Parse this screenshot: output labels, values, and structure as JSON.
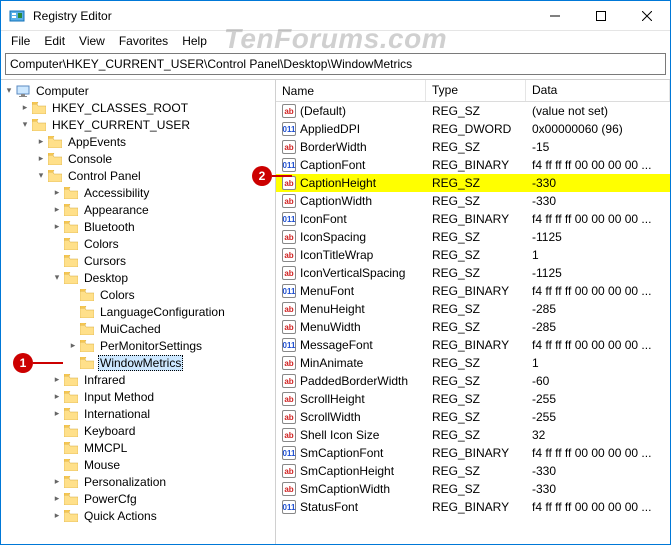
{
  "window": {
    "title": "Registry Editor"
  },
  "watermark": "TenForums.com",
  "menubar": [
    "File",
    "Edit",
    "View",
    "Favorites",
    "Help"
  ],
  "pathbar": "Computer\\HKEY_CURRENT_USER\\Control Panel\\Desktop\\WindowMetrics",
  "annotations": {
    "1": "1",
    "2": "2"
  },
  "tree": {
    "root": "Computer",
    "children": [
      {
        "label": "HKEY_CLASSES_ROOT",
        "exp": "right"
      },
      {
        "label": "HKEY_CURRENT_USER",
        "exp": "down",
        "children": [
          {
            "label": "AppEvents",
            "exp": "right"
          },
          {
            "label": "Console",
            "exp": "right"
          },
          {
            "label": "Control Panel",
            "exp": "down",
            "children": [
              {
                "label": "Accessibility",
                "exp": "right"
              },
              {
                "label": "Appearance",
                "exp": "right"
              },
              {
                "label": "Bluetooth",
                "exp": "right"
              },
              {
                "label": "Colors",
                "exp": "none"
              },
              {
                "label": "Cursors",
                "exp": "none"
              },
              {
                "label": "Desktop",
                "exp": "down",
                "children": [
                  {
                    "label": "Colors",
                    "exp": "none"
                  },
                  {
                    "label": "LanguageConfiguration",
                    "exp": "none"
                  },
                  {
                    "label": "MuiCached",
                    "exp": "none"
                  },
                  {
                    "label": "PerMonitorSettings",
                    "exp": "right"
                  },
                  {
                    "label": "WindowMetrics",
                    "exp": "none",
                    "selected": true
                  }
                ]
              },
              {
                "label": "Infrared",
                "exp": "right"
              },
              {
                "label": "Input Method",
                "exp": "right"
              },
              {
                "label": "International",
                "exp": "right"
              },
              {
                "label": "Keyboard",
                "exp": "none"
              },
              {
                "label": "MMCPL",
                "exp": "none"
              },
              {
                "label": "Mouse",
                "exp": "none"
              },
              {
                "label": "Personalization",
                "exp": "right"
              },
              {
                "label": "PowerCfg",
                "exp": "right"
              },
              {
                "label": "Quick Actions",
                "exp": "right"
              }
            ]
          }
        ]
      }
    ]
  },
  "list": {
    "columns": {
      "name": "Name",
      "type": "Type",
      "data": "Data"
    },
    "rows": [
      {
        "icon": "sz",
        "name": "(Default)",
        "type": "REG_SZ",
        "data": "(value not set)"
      },
      {
        "icon": "bin",
        "name": "AppliedDPI",
        "type": "REG_DWORD",
        "data": "0x00000060 (96)"
      },
      {
        "icon": "sz",
        "name": "BorderWidth",
        "type": "REG_SZ",
        "data": "-15"
      },
      {
        "icon": "bin",
        "name": "CaptionFont",
        "type": "REG_BINARY",
        "data": "f4 ff ff ff 00 00 00 00 ..."
      },
      {
        "icon": "sz",
        "name": "CaptionHeight",
        "type": "REG_SZ",
        "data": "-330",
        "selected": true
      },
      {
        "icon": "sz",
        "name": "CaptionWidth",
        "type": "REG_SZ",
        "data": "-330"
      },
      {
        "icon": "bin",
        "name": "IconFont",
        "type": "REG_BINARY",
        "data": "f4 ff ff ff 00 00 00 00 ..."
      },
      {
        "icon": "sz",
        "name": "IconSpacing",
        "type": "REG_SZ",
        "data": "-1125"
      },
      {
        "icon": "sz",
        "name": "IconTitleWrap",
        "type": "REG_SZ",
        "data": "1"
      },
      {
        "icon": "sz",
        "name": "IconVerticalSpacing",
        "type": "REG_SZ",
        "data": "-1125"
      },
      {
        "icon": "bin",
        "name": "MenuFont",
        "type": "REG_BINARY",
        "data": "f4 ff ff ff 00 00 00 00 ..."
      },
      {
        "icon": "sz",
        "name": "MenuHeight",
        "type": "REG_SZ",
        "data": "-285"
      },
      {
        "icon": "sz",
        "name": "MenuWidth",
        "type": "REG_SZ",
        "data": "-285"
      },
      {
        "icon": "bin",
        "name": "MessageFont",
        "type": "REG_BINARY",
        "data": "f4 ff ff ff 00 00 00 00 ..."
      },
      {
        "icon": "sz",
        "name": "MinAnimate",
        "type": "REG_SZ",
        "data": "1"
      },
      {
        "icon": "sz",
        "name": "PaddedBorderWidth",
        "type": "REG_SZ",
        "data": "-60"
      },
      {
        "icon": "sz",
        "name": "ScrollHeight",
        "type": "REG_SZ",
        "data": "-255"
      },
      {
        "icon": "sz",
        "name": "ScrollWidth",
        "type": "REG_SZ",
        "data": "-255"
      },
      {
        "icon": "sz",
        "name": "Shell Icon Size",
        "type": "REG_SZ",
        "data": "32"
      },
      {
        "icon": "bin",
        "name": "SmCaptionFont",
        "type": "REG_BINARY",
        "data": "f4 ff ff ff 00 00 00 00 ..."
      },
      {
        "icon": "sz",
        "name": "SmCaptionHeight",
        "type": "REG_SZ",
        "data": "-330"
      },
      {
        "icon": "sz",
        "name": "SmCaptionWidth",
        "type": "REG_SZ",
        "data": "-330"
      },
      {
        "icon": "bin",
        "name": "StatusFont",
        "type": "REG_BINARY",
        "data": "f4 ff ff ff 00 00 00 00 ..."
      }
    ]
  }
}
